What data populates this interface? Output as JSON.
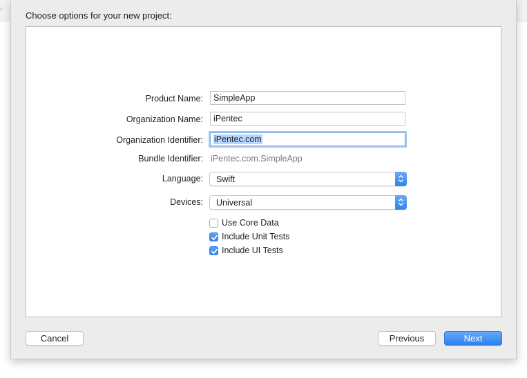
{
  "dialog": {
    "title": "Choose options for your new project:"
  },
  "form": {
    "product_name": {
      "label": "Product Name:",
      "value": "SimpleApp"
    },
    "organization_name": {
      "label": "Organization Name:",
      "value": "iPentec"
    },
    "organization_identifier": {
      "label": "Organization Identifier:",
      "value": "iPentec.com"
    },
    "bundle_identifier": {
      "label": "Bundle Identifier:",
      "value": "iPentec.com.SimpleApp"
    },
    "language": {
      "label": "Language:",
      "selected": "Swift"
    },
    "devices": {
      "label": "Devices:",
      "selected": "Universal"
    },
    "checkboxes": [
      {
        "label": "Use Core Data",
        "checked": false
      },
      {
        "label": "Include Unit Tests",
        "checked": true
      },
      {
        "label": "Include UI Tests",
        "checked": true
      }
    ]
  },
  "buttons": {
    "cancel": "Cancel",
    "previous": "Previous",
    "next": "Next"
  },
  "icons": {
    "popup_arrows": "up-down-chevron-icon",
    "checkmark": "checkmark-icon"
  },
  "colors": {
    "accent": "#2f81eb",
    "selection": "#b5d5ff"
  }
}
